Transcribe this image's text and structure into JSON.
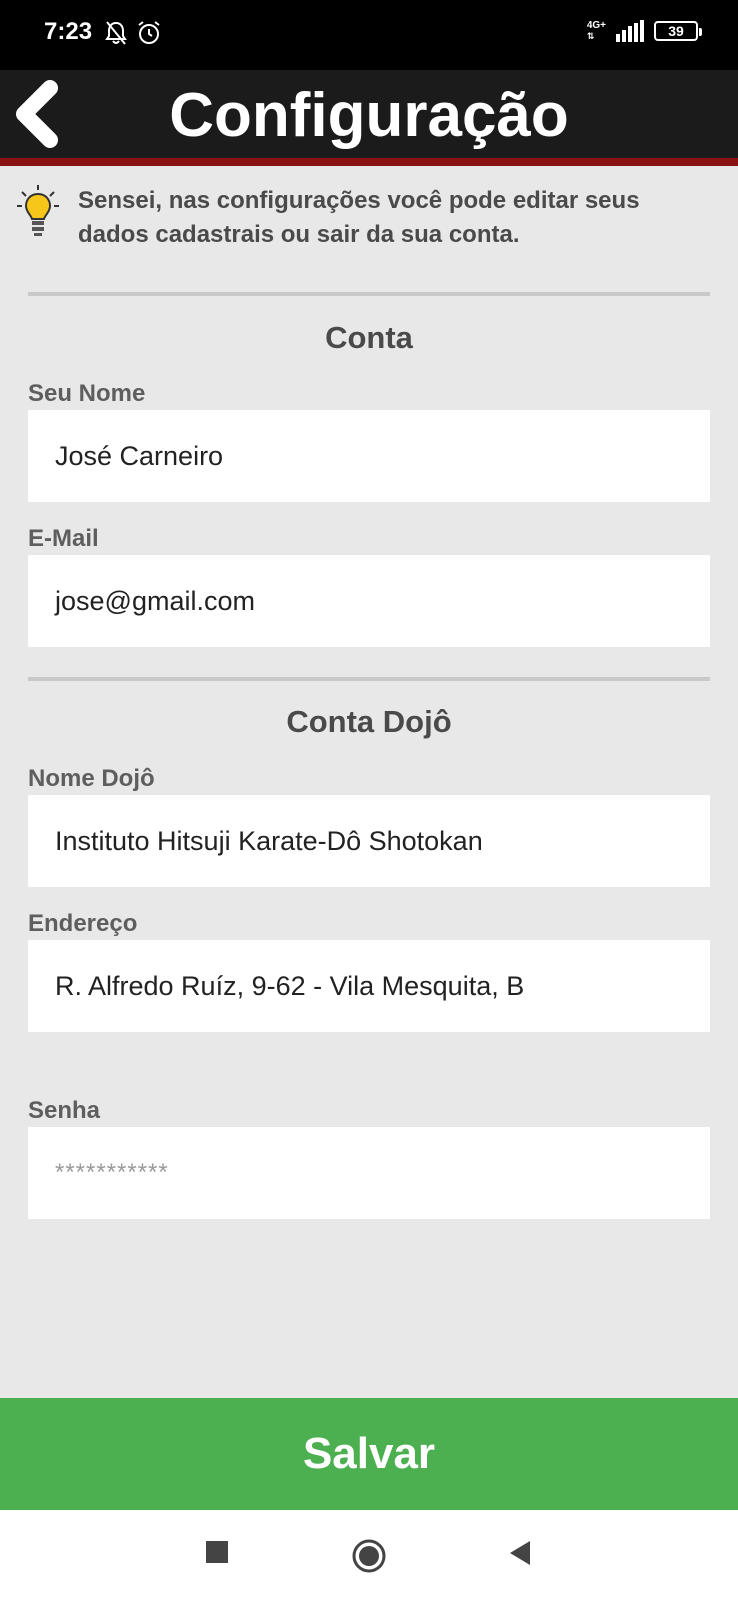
{
  "status_bar": {
    "time": "7:23",
    "network": "4G+",
    "battery": "39",
    "icons": [
      "notifications-off-icon",
      "alarm-icon",
      "signal-icon",
      "battery-icon"
    ]
  },
  "header": {
    "title": "Configuração",
    "back_icon": "chevron-left-icon",
    "background": "#1b1b1b",
    "accent": "#8b1212"
  },
  "tip": {
    "icon": "lightbulb-icon",
    "text": "Sensei, nas configurações você pode editar seus dados cadastrais ou sair da sua conta."
  },
  "account": {
    "section_title": "Conta",
    "name_label": "Seu Nome",
    "name_value": "José Carneiro",
    "email_label": "E-Mail",
    "email_value": "jose@gmail.com"
  },
  "dojo": {
    "section_title": "Conta Dojô",
    "dojo_name_label": "Nome Dojô",
    "dojo_name_value": "Instituto Hitsuji Karate-Dô Shotokan",
    "address_label": "Endereço",
    "address_value": "R. Alfredo Ruíz, 9-62 - Vila Mesquita, B"
  },
  "password": {
    "label": "Senha",
    "placeholder": "***********"
  },
  "save_button": {
    "label": "Salvar",
    "color": "#4caf50"
  },
  "nav_bar": {
    "icons": [
      "recent-apps-icon",
      "home-icon",
      "back-icon"
    ]
  }
}
